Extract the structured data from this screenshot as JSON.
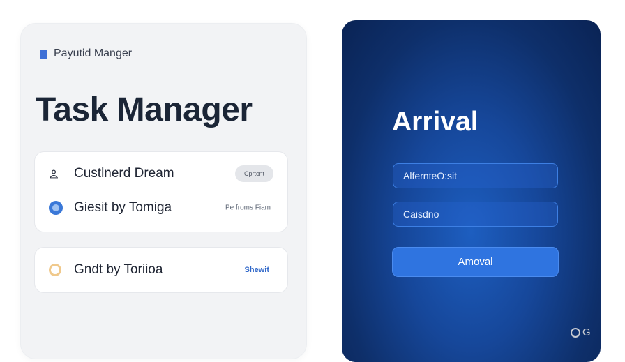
{
  "left_panel": {
    "app_name": "Payutid Manger",
    "title": "Task Manager",
    "card_1": {
      "items": [
        {
          "label": "Custlnerd Dream",
          "action": "Cprtcnt",
          "icon": "user-icon"
        },
        {
          "label": "Giesit by Tomiga",
          "action": "Pe froms Fiam",
          "icon": "globe-icon"
        }
      ]
    },
    "card_2": {
      "items": [
        {
          "label": "Gndt by Toriioa",
          "action": "Shewit",
          "icon": "ring-icon"
        }
      ]
    }
  },
  "right_panel": {
    "title": "Arrival",
    "field_1_placeholder": "AlfernteO:sit",
    "field_2_placeholder": "Caisdno",
    "submit_label": "Amoval"
  },
  "watermark": {
    "text": "G"
  },
  "colors": {
    "accent_blue": "#2f74e0",
    "dark_navy": "#0e2f6a",
    "panel_gray": "#f2f3f5",
    "title_text": "#1b2536"
  }
}
